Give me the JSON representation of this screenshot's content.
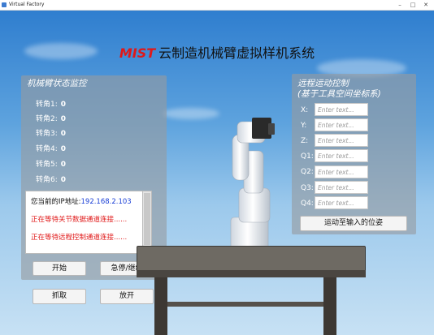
{
  "window": {
    "title": "Virtual Factory"
  },
  "header": {
    "brand": "MIST",
    "title": "云制造机械臂虚拟样机系统"
  },
  "status_panel": {
    "title": "机械臂状态监控",
    "joints": [
      {
        "label": "转角1:",
        "value": "0"
      },
      {
        "label": "转角2:",
        "value": "0"
      },
      {
        "label": "转角3:",
        "value": "0"
      },
      {
        "label": "转角4:",
        "value": "0"
      },
      {
        "label": "转角5:",
        "value": "0"
      },
      {
        "label": "转角6:",
        "value": "0"
      }
    ],
    "log": {
      "ip_label": "您当前的IP地址:",
      "ip_value": "192.168.2.103",
      "line1": "正在等待关节数据通道连接......",
      "line2": "正在等待远程控制通道连接......"
    },
    "buttons": {
      "start": "开始",
      "emergency": "急停/继续",
      "grab": "抓取",
      "release": "放开"
    }
  },
  "remote_panel": {
    "title_line1": "远程运动控制",
    "title_line2": "(基于工具空间坐标系)",
    "fields": [
      {
        "label": "X:",
        "placeholder": "Enter text..."
      },
      {
        "label": "Y:",
        "placeholder": "Enter text..."
      },
      {
        "label": "Z:",
        "placeholder": "Enter text..."
      },
      {
        "label": "Q1:",
        "placeholder": "Enter text..."
      },
      {
        "label": "Q2:",
        "placeholder": "Enter text..."
      },
      {
        "label": "Q3:",
        "placeholder": "Enter text..."
      },
      {
        "label": "Q4:",
        "placeholder": "Enter text..."
      }
    ],
    "move_button": "运动至输入的位姿"
  },
  "colors": {
    "brand": "#e01818",
    "ip": "#1a3fd6",
    "warning": "#e01818",
    "panel": "#969ba0"
  }
}
